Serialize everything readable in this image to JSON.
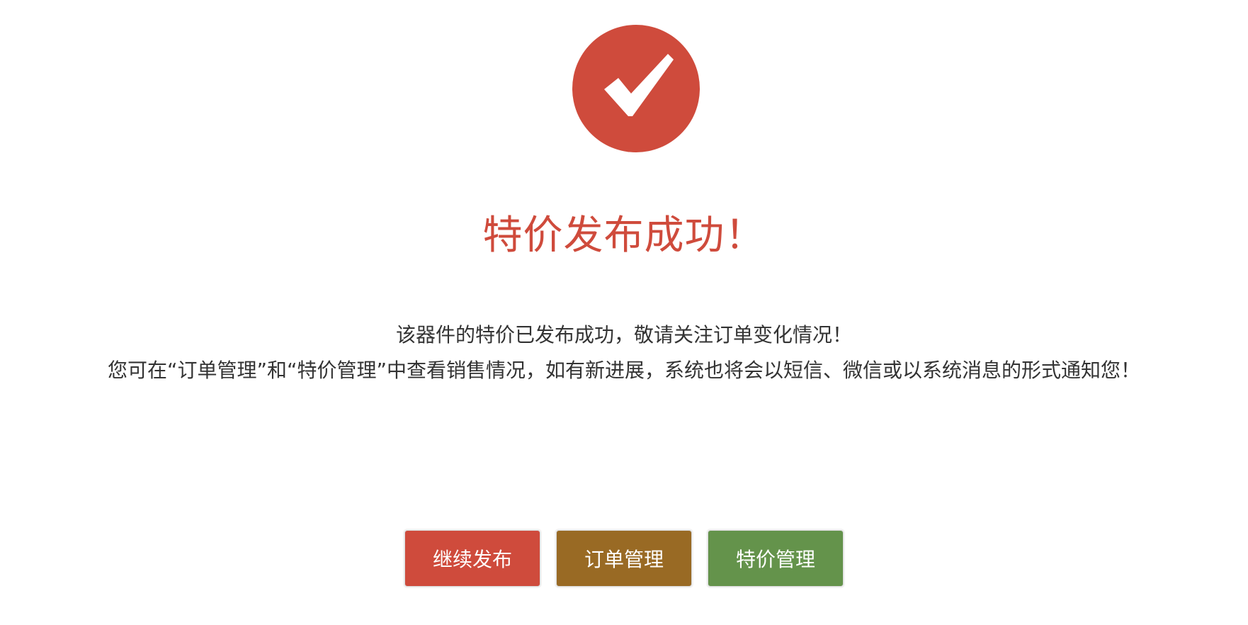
{
  "colors": {
    "accent_red": "#cf4b3c",
    "button_brown": "#996a24",
    "button_green": "#64934b"
  },
  "icon": {
    "name": "check-circle-icon"
  },
  "title": "特价发布成功！",
  "message": {
    "line1": "该器件的特价已发布成功，敬请关注订单变化情况！",
    "line2": "您可在“订单管理”和“特价管理”中查看销售情况，如有新进展，系统也将会以短信、微信或以系统消息的形式通知您！"
  },
  "buttons": {
    "continue_publish": "继续发布",
    "order_management": "订单管理",
    "special_price_management": "特价管理"
  }
}
